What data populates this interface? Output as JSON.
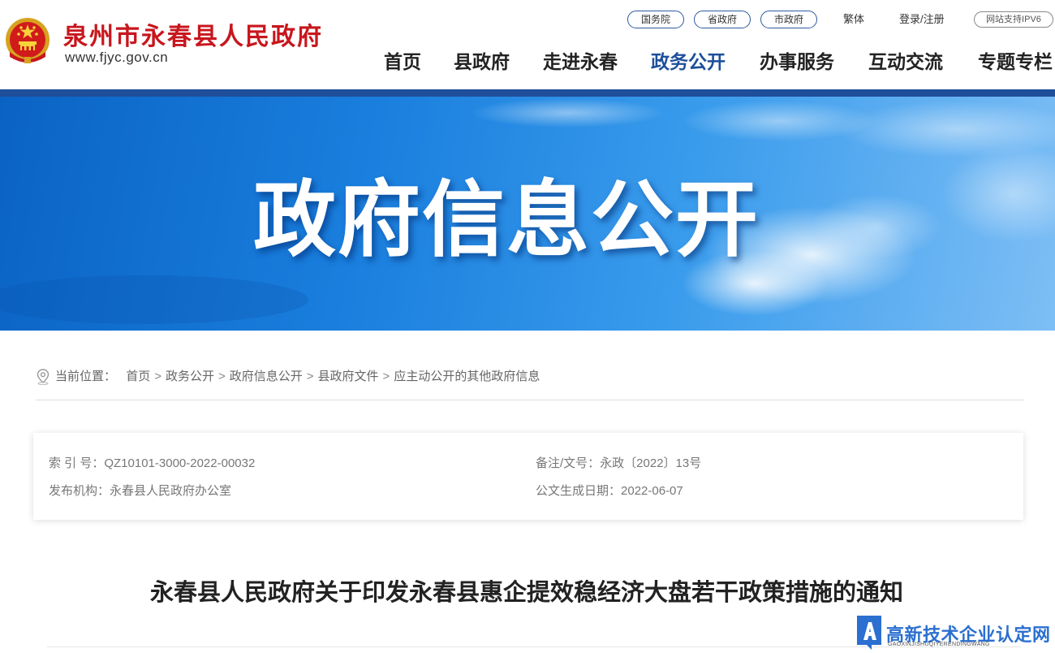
{
  "header": {
    "site_name": "泉州市永春县人民政府",
    "site_url": "www.fjyc.gov.cn",
    "emblem_icon": "national-emblem-icon",
    "top_links": {
      "guowuyuan": "国务院",
      "shengzhengfu": "省政府",
      "shizhengfu": "市政府",
      "traditional": "繁体",
      "login": "登录/注册",
      "ipv6": "网站支持IPV6"
    },
    "nav": {
      "home": "首页",
      "county_gov": "县政府",
      "about": "走进永春",
      "gov_affairs": "政务公开",
      "services": "办事服务",
      "interaction": "互动交流",
      "special": "专题专栏"
    },
    "active_nav": "gov_affairs"
  },
  "banner": {
    "title": "政府信息公开"
  },
  "breadcrumb": {
    "label": "当前位置：",
    "items": [
      "首页",
      "政务公开",
      "政府信息公开",
      "县政府文件",
      "应主动公开的其他政府信息"
    ],
    "separator": ">",
    "icon": "location-pin-icon"
  },
  "info": {
    "index_label": "索 引 号：",
    "index_value": "QZ10101-3000-2022-00032",
    "doc_no_label": "备注/文号：",
    "doc_no_value": "永政〔2022〕13号",
    "publisher_label": "发布机构：",
    "publisher_value": "永春县人民政府办公室",
    "date_label": "公文生成日期：",
    "date_value": "2022-06-07"
  },
  "document": {
    "title": "永春县人民政府关于印发永春县惠企提效稳经济大盘若干政策措施的通知"
  },
  "watermark": {
    "text": "高新技术企业认定网",
    "sub": "GAOXINJISHUQIYERENDINGWANG",
    "icon": "letter-a-logo-icon"
  },
  "colors": {
    "brand_red": "#c8161d",
    "brand_blue": "#1f4e9a",
    "active_nav": "#1d4f9c",
    "banner_blue": "#1a7fde",
    "watermark_blue": "#2b6fd0"
  }
}
